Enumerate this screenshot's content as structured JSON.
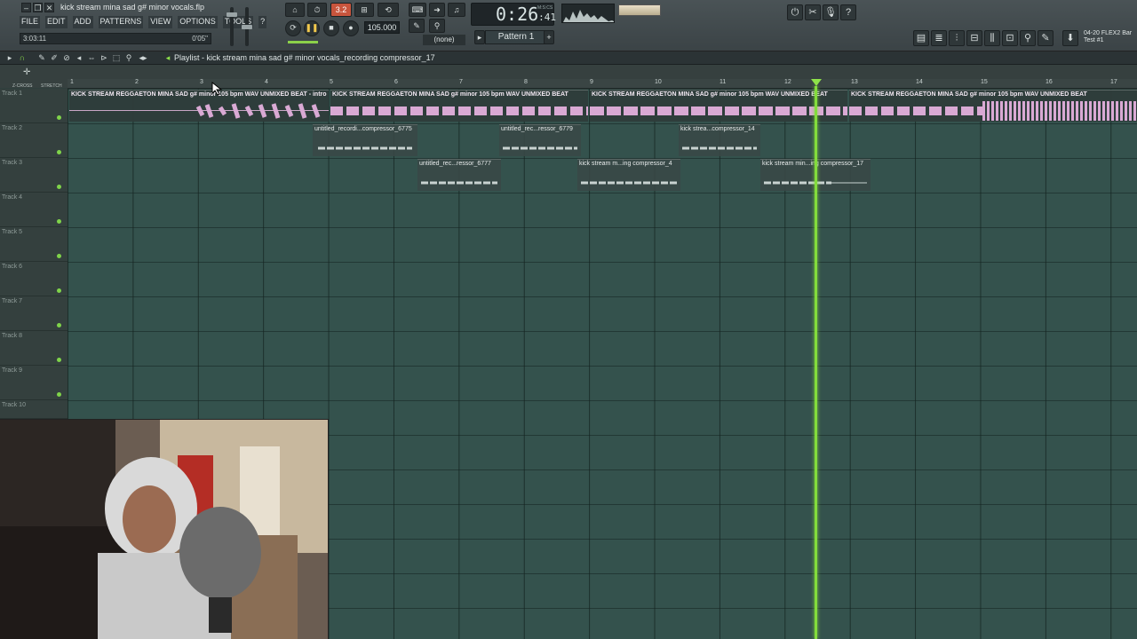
{
  "window": {
    "file_title": "kick stream mina sad g# minor vocals.flp",
    "minimize": "–",
    "restore": "❐",
    "close": "✕"
  },
  "menu": [
    "FILE",
    "EDIT",
    "ADD",
    "PATTERNS",
    "VIEW",
    "OPTIONS",
    "TOOLS",
    "?"
  ],
  "hint": {
    "left": "3:03:11",
    "right": "0'05\""
  },
  "transport": {
    "time_main": "0:26",
    "time_sub": ":41",
    "time_unit": "M:S:CS",
    "tempo": "105.000",
    "pattern": "Pattern 1",
    "pattern_add": "+",
    "pattern_none": "(none)",
    "song_label": "3.2",
    "play_icon": "❚❚",
    "stop_icon": "■",
    "record_icon": "●"
  },
  "plugin": {
    "line1": "04-20  FLEX2 Bar",
    "line2": "Test #1"
  },
  "playlist": {
    "title": "Playlist - kick stream mina sad g# minor vocals_recording compressor_17",
    "bars": [
      "1",
      "2",
      "3",
      "4",
      "5",
      "6",
      "7",
      "8",
      "9",
      "10",
      "11",
      "12",
      "13",
      "14",
      "15",
      "16",
      "17"
    ],
    "ruler_left": "Z-CROSS",
    "ruler_right": "STRETCH"
  },
  "tracks": [
    "Track 1",
    "Track 2",
    "Track 3",
    "Track 4",
    "Track 5",
    "Track 6",
    "Track 7",
    "Track 8",
    "Track 9",
    "Track 10"
  ],
  "clips": {
    "t1": [
      "KICK STREAM REGGAETON MINA SAD g# minor 105 bpm WAV UNMIXED BEAT - intro",
      "KICK STREAM REGGAETON MINA SAD g# minor 105 bpm WAV UNMIXED BEAT",
      "KICK STREAM REGGAETON MINA SAD g# minor 105 bpm WAV UNMIXED BEAT",
      "KICK STREAM REGGAETON MINA SAD g# minor 105 bpm WAV UNMIXED BEAT"
    ],
    "t2": [
      "untitled_recordi...compressor_6775",
      "untitled_rec...ressor_6779",
      "kick strea...compressor_14"
    ],
    "t3": [
      "untitled_rec...ressor_6777",
      "kick stream m...ing compressor_4",
      "kick stream min...ing compressor_17"
    ]
  },
  "colors": {
    "playhead": "#83dd3c",
    "grid": "#34524d",
    "clip_top": "#d9a9d4"
  },
  "icons": {
    "magnet": "magnet-icon",
    "pencil": "pencil-icon",
    "brush": "brush-icon",
    "zoom": "zoom-icon"
  }
}
